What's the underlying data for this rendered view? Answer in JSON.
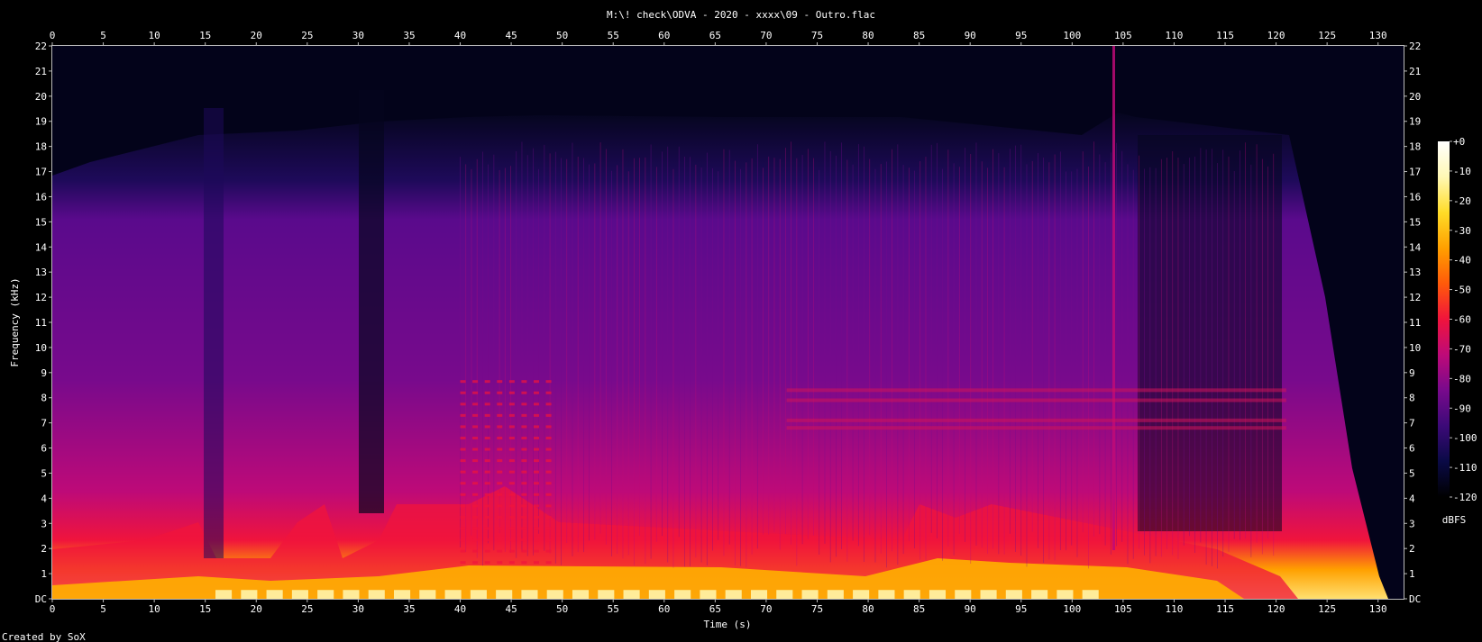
{
  "chart_data": {
    "type": "heatmap",
    "title": "M:\\! check\\ODVA - 2020 - xxxx\\09 - Outro.flac",
    "xlabel": "Time (s)",
    "ylabel": "Frequency (kHz)",
    "xlim": [
      0,
      132.5
    ],
    "ylim": [
      0,
      22
    ],
    "x_ticks": [
      0,
      5,
      10,
      15,
      20,
      25,
      30,
      35,
      40,
      45,
      50,
      55,
      60,
      65,
      70,
      75,
      80,
      85,
      90,
      95,
      100,
      105,
      110,
      115,
      120,
      125,
      130
    ],
    "y_ticks": [
      "DC",
      "1",
      "2",
      "3",
      "4",
      "5",
      "6",
      "7",
      "8",
      "9",
      "10",
      "11",
      "12",
      "13",
      "14",
      "15",
      "16",
      "17",
      "18",
      "19",
      "20",
      "21",
      "22"
    ],
    "colorbar": {
      "label": "dBFS",
      "range": [
        -120,
        0
      ],
      "ticks": [
        "+0",
        "-10",
        "-20",
        "-30",
        "-40",
        "-50",
        "-60",
        "-70",
        "-80",
        "-90",
        "-100",
        "-110",
        "-120"
      ],
      "colors": [
        "#000000",
        "#0a0a46",
        "#3c0a78",
        "#780a8c",
        "#be0a78",
        "#f0143c",
        "#ff5a0a",
        "#ffa000",
        "#ffdc28",
        "#fff8b4",
        "#ffffff"
      ]
    },
    "grid": false,
    "legend": "right"
  },
  "footer": "Created by SoX"
}
